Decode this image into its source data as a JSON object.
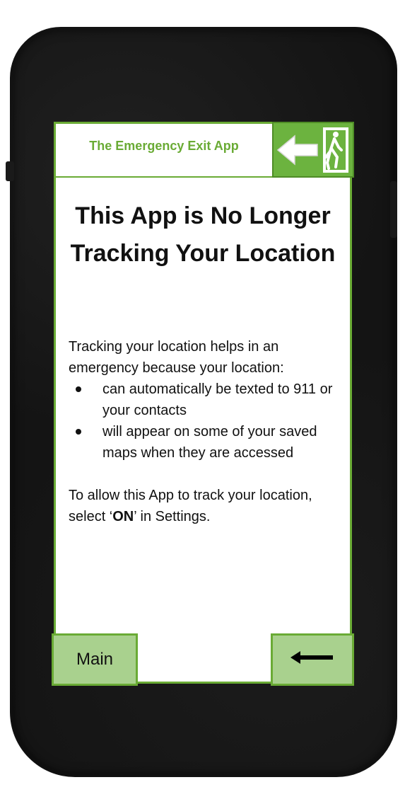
{
  "header": {
    "app_title": "The Emergency Exit App",
    "logo_icon": "emergency-exit-icon"
  },
  "headline": "This App is No Longer Tracking Your Location",
  "body": {
    "intro": "Tracking your location helps in an emergency because your location:",
    "bullets": [
      "can automatically be texted to 911 or your contacts",
      "will appear on some of your saved maps when they are accessed"
    ],
    "settings_prefix": "To allow this App to track your location, select ‘",
    "settings_keyword": "ON",
    "settings_suffix": "’ in Settings."
  },
  "nav": {
    "main_label": "Main",
    "back_icon": "arrow-left-icon"
  },
  "colors": {
    "accent_green": "#6aab35",
    "button_green": "#a9d18e",
    "logo_green": "#6cb33f",
    "phone_body": "#141414"
  }
}
